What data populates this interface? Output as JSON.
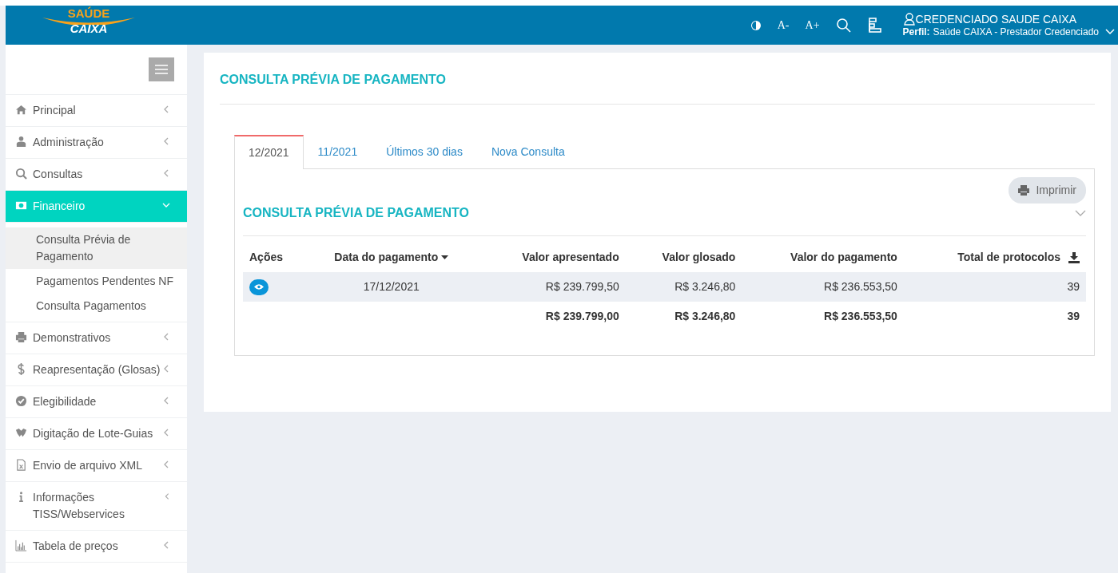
{
  "logo": {
    "top": "SAÚDE",
    "bottom": "CAIXA"
  },
  "header_tools": [
    "A-",
    "A+"
  ],
  "user": {
    "name": "CREDENCIADO SAUDE CAIXA",
    "profile_label": "Perfil:",
    "profile": "Saúde CAIXA - Prestador Credenciado"
  },
  "sidebar": {
    "items": [
      {
        "label": "Principal",
        "expanded": false,
        "selected": false
      },
      {
        "label": "Administração",
        "expanded": false,
        "selected": false
      },
      {
        "label": "Consultas",
        "expanded": false,
        "selected": false
      },
      {
        "label": "Financeiro",
        "expanded": true,
        "selected": true,
        "children": [
          {
            "label": "Consulta Prévia de Pagamento",
            "selected": true
          },
          {
            "label": "Pagamentos Pendentes NF",
            "selected": false
          },
          {
            "label": "Consulta Pagamentos",
            "selected": false
          }
        ]
      },
      {
        "label": "Demonstrativos",
        "expanded": false,
        "selected": false
      },
      {
        "label": "Reapresentação (Glosas)",
        "expanded": false,
        "selected": false
      },
      {
        "label": "Elegibilidade",
        "expanded": false,
        "selected": false
      },
      {
        "label": "Digitação de Lote-Guias",
        "expanded": false,
        "selected": false
      },
      {
        "label": "Envio de arquivo XML",
        "expanded": false,
        "selected": false
      },
      {
        "label": "Informações TISS/Webservices",
        "expanded": false,
        "selected": false
      },
      {
        "label": "Tabela de preços",
        "expanded": false,
        "selected": false
      }
    ]
  },
  "page_title": "CONSULTA PRÉVIA DE PAGAMENTO",
  "tabs": [
    {
      "label": "12/2021",
      "selected": true
    },
    {
      "label": "11/2021",
      "selected": false
    },
    {
      "label": "Últimos 30 dias",
      "selected": false
    },
    {
      "label": "Nova Consulta",
      "selected": false
    }
  ],
  "print_button": "Imprimir",
  "section_title": "CONSULTA PRÉVIA DE PAGAMENTO",
  "table": {
    "columns": [
      "Ações",
      "Data do pagamento",
      "Valor apresentado",
      "Valor glosado",
      "Valor do pagamento",
      "Total de protocolos"
    ],
    "rows": [
      [
        null,
        "17/12/2021",
        "R$ 239.799,50",
        "R$ 3.246,80",
        "R$ 236.553,50",
        "39"
      ]
    ],
    "totals": [
      "R$ 239.799,00",
      "R$ 3.246,80",
      "R$ 236.553,50",
      "39"
    ]
  }
}
